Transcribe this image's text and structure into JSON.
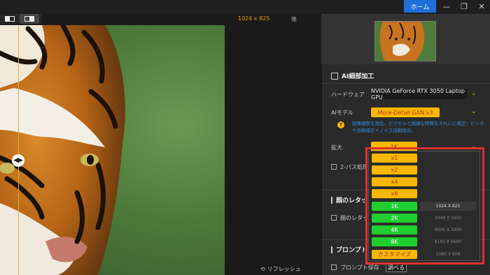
{
  "toolbar": {
    "image_size": "1024 x 825",
    "after_label": "後",
    "home_label": "ホーム",
    "refresh_label": "リフレッシュ"
  },
  "ai_section": {
    "title": "AI細部加工",
    "hardware_label": "ハードウェア",
    "hardware_value": "NVIDIA GeForce RTX 3050 Laptop GPU",
    "model_label": "AIモデル",
    "model_value": "More-Detail GAN  v3",
    "model_desc": "画像細部を強化。ピクセルと微細な特徴をきれいに補正！ピンボケ自動補正＋ノイズ自動除去。",
    "scale_label": "拡大",
    "scale_value": "1K",
    "twopass_label": "2-パス処理"
  },
  "face_section": {
    "title": "顔のレタッチ",
    "retouch_label": "顔のレタッチ"
  },
  "prompt_section": {
    "title": "プロンプト",
    "save_label": "プロンプト保存",
    "check_button": "調べる"
  },
  "dropdown": {
    "options": [
      {
        "label": "x1",
        "res": ""
      },
      {
        "label": "x2",
        "res": ""
      },
      {
        "label": "x4",
        "res": ""
      },
      {
        "label": "x8",
        "res": ""
      },
      {
        "label": "1K",
        "res": "1024 X 825"
      },
      {
        "label": "2K",
        "res": "2048 X 1650"
      },
      {
        "label": "4K",
        "res": "4096 X 3300"
      },
      {
        "label": "8K",
        "res": "8192 X 6600"
      },
      {
        "label": "カスタマイズ",
        "res": "1080 X 608"
      }
    ]
  },
  "colors": {
    "accent_orange": "#f7b800",
    "accent_green": "#1fcf2f",
    "home_blue": "#1e6fd9",
    "highlight_red": "#e03030"
  }
}
